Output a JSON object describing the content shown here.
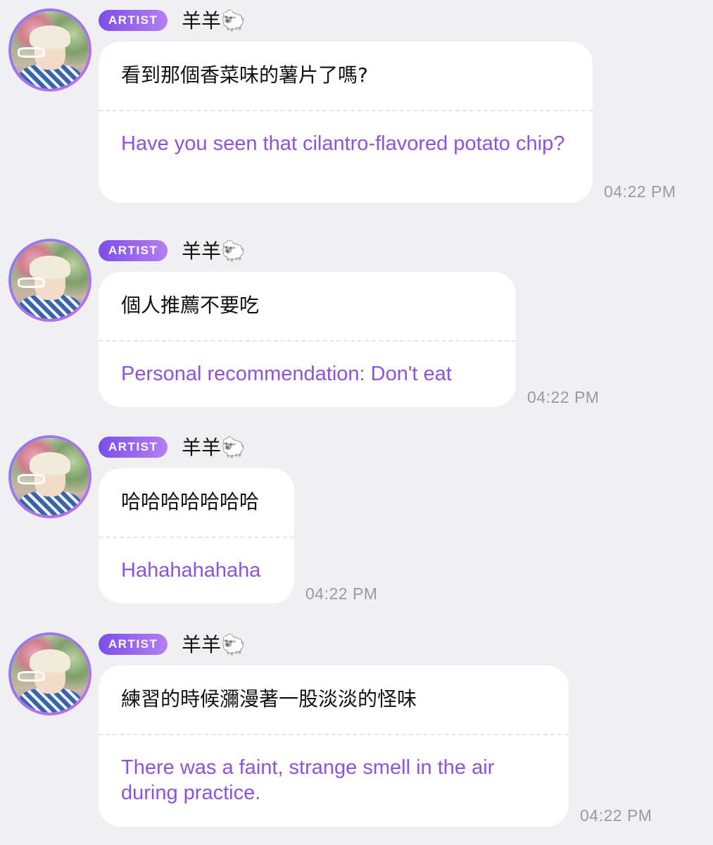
{
  "messages": [
    {
      "badge": "ARTIST",
      "sender": "羊羊🐑",
      "original": "看到那個香菜味的薯片了嗎?",
      "translation": "Have you seen that cilantro-flavored potato chip?",
      "time": "04:22 PM"
    },
    {
      "badge": "ARTIST",
      "sender": "羊羊🐑",
      "original": "個人推薦不要吃",
      "translation": "Personal recommendation: Don't eat",
      "time": "04:22 PM"
    },
    {
      "badge": "ARTIST",
      "sender": "羊羊🐑",
      "original": "哈哈哈哈哈哈哈",
      "translation": "Hahahahahaha",
      "time": "04:22 PM"
    },
    {
      "badge": "ARTIST",
      "sender": "羊羊🐑",
      "original": "練習的時候瀰漫著一股淡淡的怪味",
      "translation": "There was a faint, strange smell in the air during practice.",
      "time": "04:22 PM"
    }
  ],
  "colors": {
    "background": "#f0f0f3",
    "bubble": "#ffffff",
    "translation_text": "#8f52d9",
    "badge_gradient_start": "#7b4ee8",
    "badge_gradient_end": "#b47ef2",
    "timestamp": "#9a9a9e"
  },
  "icons": {
    "avatar": "profile-photo",
    "sender_emoji": "sheep"
  }
}
